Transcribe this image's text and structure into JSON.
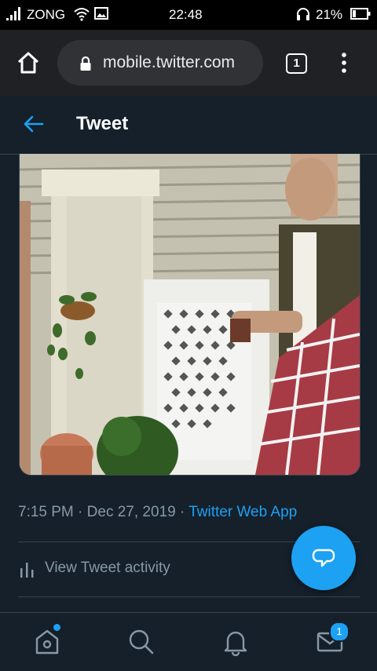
{
  "status_bar": {
    "carrier": "ZONG",
    "time": "22:48",
    "battery_percent": "21%"
  },
  "browser": {
    "url": "mobile.twitter.com",
    "tab_count": "1"
  },
  "header": {
    "title": "Tweet"
  },
  "tweet": {
    "time": "7:15 PM",
    "date": "Dec 27, 2019",
    "source": "Twitter Web App",
    "separator": "·"
  },
  "actions": {
    "view_activity": "View Tweet activity"
  },
  "bottom_nav": {
    "messages_badge": "1"
  },
  "colors": {
    "background": "#15202b",
    "accent": "#1da1f2",
    "muted_text": "#8899a6",
    "divider": "#38444d"
  }
}
